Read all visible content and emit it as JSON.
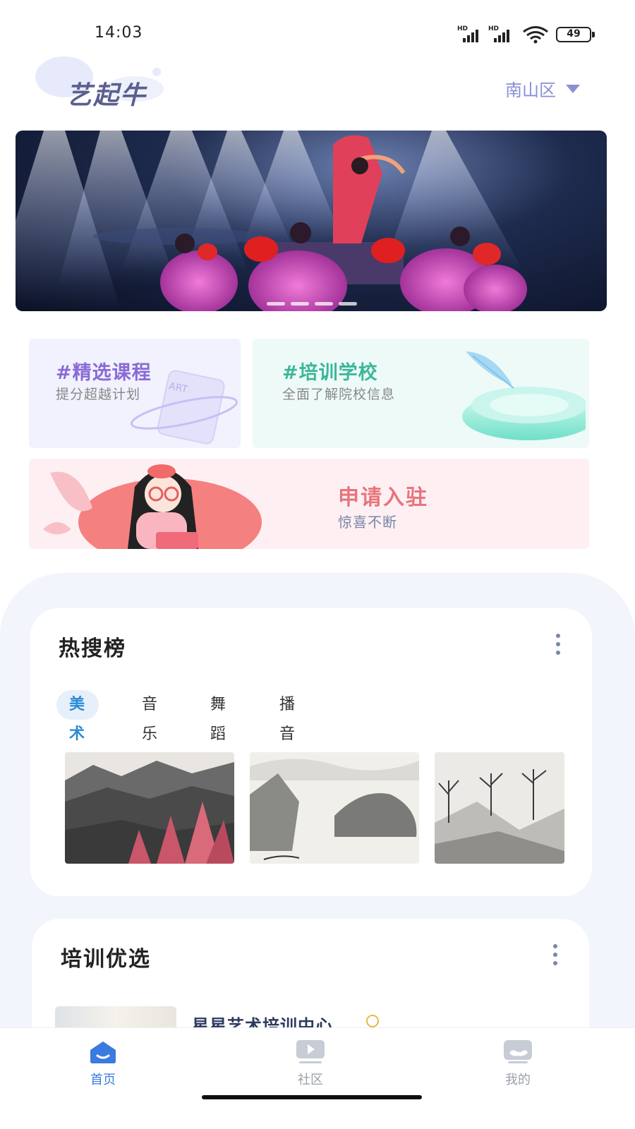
{
  "status_bar": {
    "time": "14:03",
    "signal_label": "HD",
    "battery": "49",
    "icons": [
      "signal-icon",
      "signal-icon",
      "wifi-icon",
      "battery-icon"
    ]
  },
  "header": {
    "app_name": "艺起牛",
    "district": "南山区"
  },
  "banner": {
    "page_count": 4,
    "active_index": 0
  },
  "features": {
    "courses": {
      "title": "#精选课程",
      "subtitle": "提分超越计划",
      "art_tag": "ART"
    },
    "schools": {
      "title": "#培训学校",
      "subtitle": "全面了解院校信息"
    },
    "apply": {
      "title": "申请入驻",
      "subtitle": "惊喜不断"
    }
  },
  "hot_search": {
    "title": "热搜榜",
    "tabs": [
      "美术",
      "音乐",
      "舞蹈",
      "播音主持"
    ],
    "active_tab": 0
  },
  "training": {
    "title": "培训优选",
    "first_school": "星星艺术培训中心"
  },
  "tabbar": {
    "items": [
      {
        "label": "首页",
        "icon": "home-icon"
      },
      {
        "label": "社区",
        "icon": "play-icon"
      },
      {
        "label": "我的",
        "icon": "profile-icon"
      }
    ],
    "active": 0
  },
  "colors": {
    "accent_blue": "#3a7be0",
    "courses_title": "#8a6ad6",
    "schools_title": "#3bb79a",
    "apply_title": "#e8747c"
  }
}
